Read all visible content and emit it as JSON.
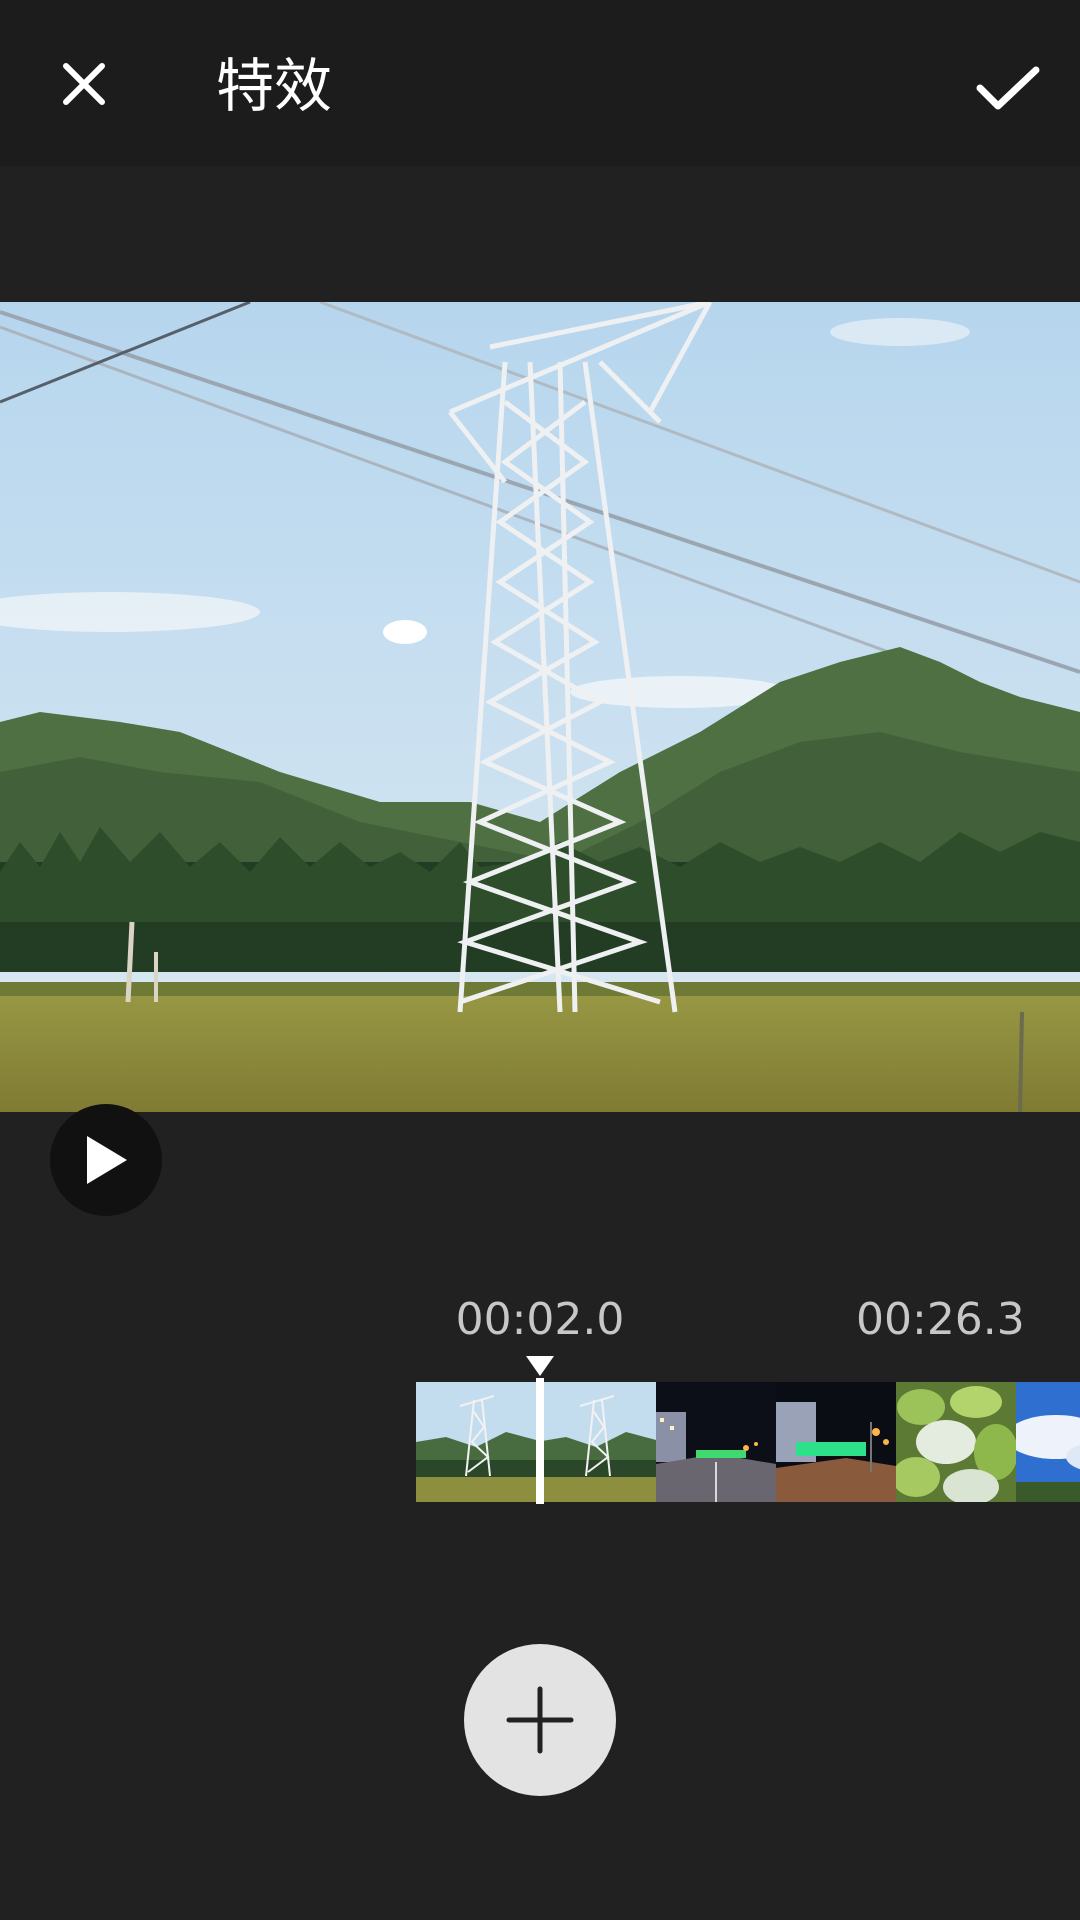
{
  "header": {
    "title": "特效",
    "close_icon": "close-icon",
    "confirm_icon": "check-icon"
  },
  "player": {
    "play_icon": "play-icon"
  },
  "timeline": {
    "current_time": "00:02.0",
    "total_time": "00:26.3",
    "clips": [
      "power-tower",
      "power-tower",
      "night-street",
      "night-street",
      "papaya-fruit",
      "sky-clouds"
    ]
  },
  "actions": {
    "add_icon": "plus-icon"
  },
  "colors": {
    "background": "#212121",
    "topbar": "#1c1c1c",
    "accent": "#ffffff"
  }
}
